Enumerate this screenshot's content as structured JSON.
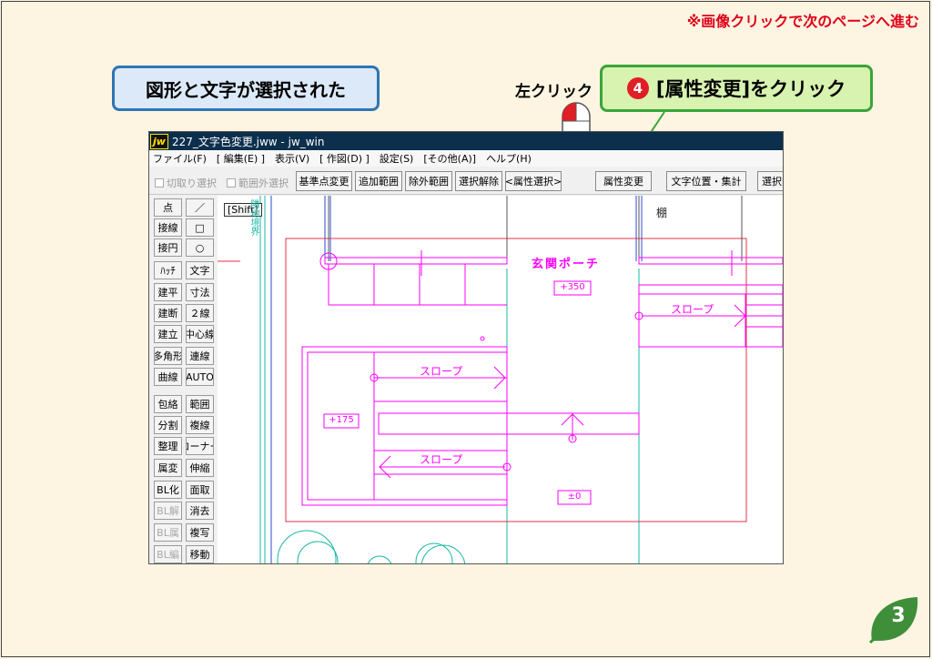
{
  "top_note": "※画像クリックで次のページへ進む",
  "callout_left": "図形と文字が選択された",
  "left_click_label": "左クリック",
  "step": {
    "number": "4",
    "text": "[属性変更]をクリック"
  },
  "window": {
    "title": "227_文字色変更.jww - jw_win",
    "logo": "jw",
    "menu": [
      "ファイル(F)",
      "[ 編集(E) ]",
      "表示(V)",
      "[ 作図(D) ]",
      "設定(S)",
      "[その他(A)]",
      "ヘルプ(H)"
    ],
    "toolbar": {
      "check_cut": "切取り選択",
      "check_outside": "範囲外選択",
      "btn_base": "基準点変更",
      "btn_add": "追加範囲",
      "btn_exclude": "除外範囲",
      "btn_clear": "選択解除",
      "btn_attrsel": "<属性選択>",
      "btn_attrchange": "属性変更",
      "btn_textpos": "文字位置・集計",
      "btn_more": "選択図"
    },
    "tools_left": [
      "点",
      "接線",
      "接円",
      "ﾊｯﾁ",
      "建平",
      "建断",
      "建立",
      "多角形",
      "曲線",
      "包絡",
      "分割",
      "整理",
      "属変",
      "BL化",
      "BL解",
      "BL属",
      "BL編"
    ],
    "tools_right": [
      "／",
      "□",
      "○",
      "文字",
      "寸法",
      "２線",
      "中心線",
      "連線",
      "AUTO",
      "範囲",
      "複線",
      "コーナー",
      "伸縮",
      "面取",
      "消去",
      "複写",
      "移動"
    ],
    "canvas": {
      "shift_label": "[Shift]",
      "vertical_text": "隣地境界",
      "shelf_label": "棚",
      "porch_title": "玄関ポーチ",
      "level_350": "+350",
      "level_175": "+175",
      "level_0": "±0",
      "slope_1": "スロープ",
      "slope_2": "スロープ",
      "slope_3": "スロープ"
    }
  },
  "page_number": "3",
  "colors": {
    "magenta": "#ff00ff",
    "red_line": "#e8304a",
    "cyan": "#19b8a6",
    "blue": "#2c49d6",
    "accent_red": "#e0001a"
  }
}
